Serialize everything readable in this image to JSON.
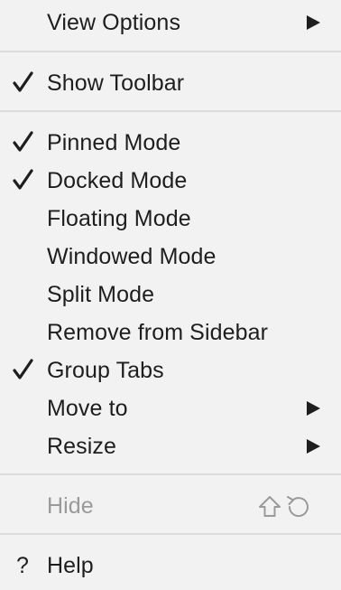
{
  "menu": {
    "view_options": "View Options",
    "show_toolbar": "Show Toolbar",
    "pinned_mode": "Pinned Mode",
    "docked_mode": "Docked Mode",
    "floating_mode": "Floating Mode",
    "windowed_mode": "Windowed Mode",
    "split_mode": "Split Mode",
    "remove_from_sidebar": "Remove from Sidebar",
    "group_tabs": "Group Tabs",
    "move_to": "Move to",
    "resize": "Resize",
    "hide": "Hide",
    "help_glyph": "?",
    "help": "Help"
  },
  "checked": {
    "show_toolbar": true,
    "pinned_mode": true,
    "docked_mode": true,
    "group_tabs": true
  },
  "hide_shortcut_icons": [
    "shift-icon",
    "escape-icon"
  ],
  "colors": {
    "background": "#f2f2f2",
    "text": "#1e1e1e",
    "disabled_text": "#9a9a9a",
    "separator": "#dcdcdc"
  }
}
